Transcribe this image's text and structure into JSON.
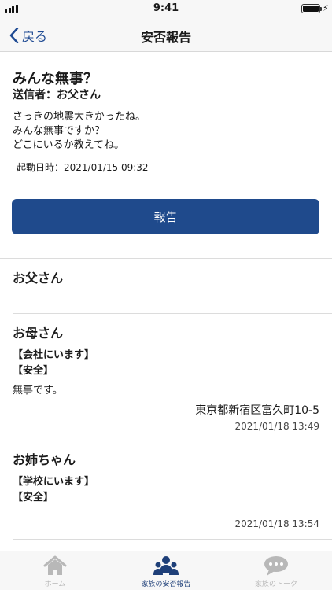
{
  "status_bar": {
    "time": "9:41"
  },
  "nav": {
    "back_label": "戻る",
    "title": "安否報告"
  },
  "message": {
    "title": "みんな無事？",
    "sender": "送信者：お父さん",
    "body": "さっきの地震大きかったね。\nみんな無事ですか？\nどこにいるか教えてね。",
    "started_at": "起動日時：2021/01/15 09:32",
    "report_button": "報告"
  },
  "members": [
    {
      "name": "お父さん"
    },
    {
      "name": "お母さん",
      "location_tag": "【会社にいます】",
      "safety_tag": "【安全】",
      "comment": "無事です。",
      "address": "東京都新宿区富久町10-5",
      "reported_at": "2021/01/18 13:49"
    },
    {
      "name": "お姉ちゃん",
      "location_tag": "【学校にいます】",
      "safety_tag": "【安全】",
      "reported_at": "2021/01/18 13:54"
    }
  ],
  "tabs": [
    {
      "label": "ホーム",
      "icon": "home-icon",
      "active": false
    },
    {
      "label": "家族の安否報告",
      "icon": "family-icon",
      "active": true
    },
    {
      "label": "家族のトーク",
      "icon": "chat-bubble-icon",
      "active": false
    }
  ],
  "colors": {
    "accent": "#1f4a8c",
    "link": "#1e4a93",
    "tab_active": "#1e3f78",
    "tab_inactive": "#b8b8b8"
  }
}
